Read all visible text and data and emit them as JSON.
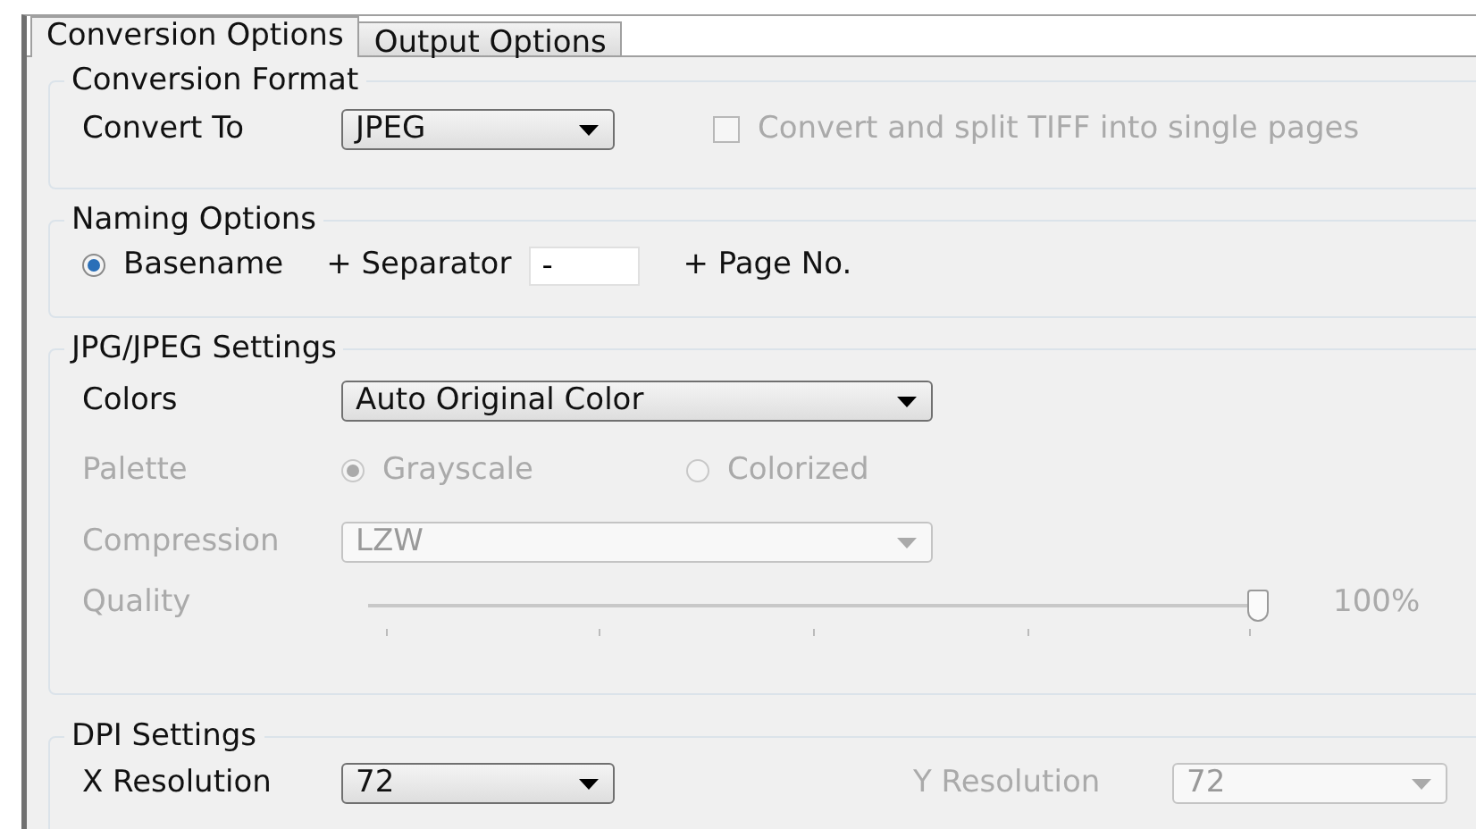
{
  "tabs": [
    {
      "label": "Conversion Options",
      "selected": true
    },
    {
      "label": "Output Options",
      "selected": false
    }
  ],
  "conversion_format": {
    "title": "Conversion Format",
    "convert_to": {
      "label": "Convert To",
      "value": "JPEG",
      "disabled": false
    },
    "split_tiff": {
      "label": "Convert and split TIFF into single pages",
      "checked": false,
      "disabled": true
    }
  },
  "naming_options": {
    "title": "Naming Options",
    "basename": {
      "label": "Basename",
      "selected": true
    },
    "separator_label": "+ Separator",
    "separator_value": "-",
    "page_label": "+ Page No."
  },
  "jpeg_settings": {
    "title": "JPG/JPEG Settings",
    "colors": {
      "label": "Colors",
      "value": "Auto Original Color",
      "disabled": false
    },
    "palette": {
      "label": "Palette",
      "disabled": true,
      "options": [
        {
          "label": "Grayscale",
          "selected": true
        },
        {
          "label": "Colorized",
          "selected": false
        }
      ]
    },
    "compression": {
      "label": "Compression",
      "value": "LZW",
      "disabled": true
    },
    "quality": {
      "label": "Quality",
      "level": 1,
      "reading": "100%",
      "disabled": true
    }
  },
  "dpi_settings": {
    "title": "DPI Settings",
    "x_resolution": {
      "label": "X Resolution",
      "value": "72",
      "disabled": false
    },
    "y_resolution": {
      "label": "Y Resolution",
      "value": "72",
      "disabled": true
    }
  }
}
